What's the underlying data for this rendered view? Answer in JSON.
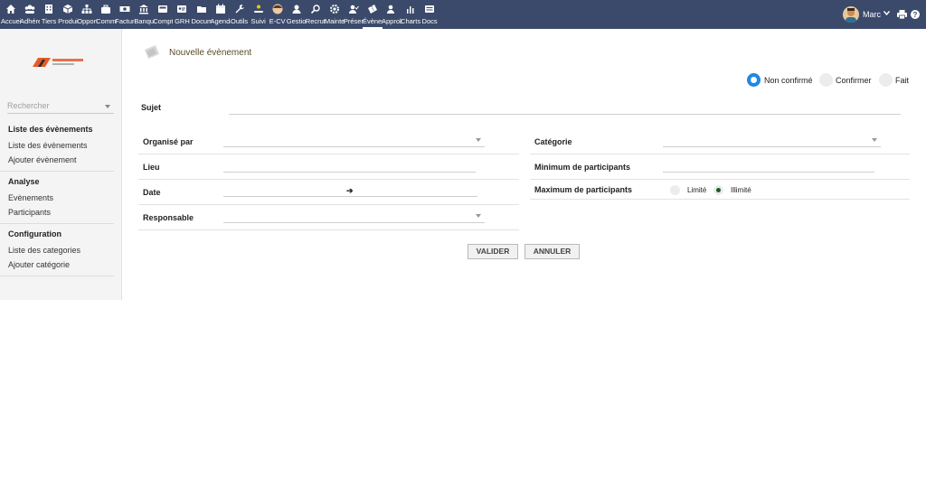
{
  "nav": {
    "items": [
      {
        "label": "Accueil",
        "icon": "home-icon"
      },
      {
        "label": "Adhérents",
        "icon": "members-icon"
      },
      {
        "label": "Tiers",
        "icon": "building-icon"
      },
      {
        "label": "Produits",
        "icon": "cube-icon"
      },
      {
        "label": "Opportunités",
        "icon": "sitemap-icon"
      },
      {
        "label": "Commercial",
        "icon": "briefcase-icon"
      },
      {
        "label": "Factures",
        "icon": "money-icon"
      },
      {
        "label": "Banque",
        "icon": "bank-icon"
      },
      {
        "label": "Comptabilité",
        "icon": "calculator-icon"
      },
      {
        "label": "GRH",
        "icon": "id-card-icon"
      },
      {
        "label": "Documents",
        "icon": "folder-icon"
      },
      {
        "label": "Agenda",
        "icon": "calendar-icon"
      },
      {
        "label": "Outils",
        "icon": "wrench-icon"
      },
      {
        "label": "Suivi",
        "icon": "hand-coin-icon"
      },
      {
        "label": "E-CV",
        "icon": "face-icon"
      },
      {
        "label": "Gestion",
        "icon": "user-tie-icon"
      },
      {
        "label": "Recrutement",
        "icon": "search-person-icon"
      },
      {
        "label": "Maintenance",
        "icon": "gear-icon"
      },
      {
        "label": "Présences",
        "icon": "person-check-icon"
      },
      {
        "label": "Évènements",
        "icon": "ticket-icon"
      },
      {
        "label": "Approbations",
        "icon": "approve-icon"
      },
      {
        "label": "Charts",
        "icon": "chart-icon"
      },
      {
        "label": "Docs",
        "icon": "db-icon"
      }
    ],
    "active_index": 19
  },
  "user": {
    "name": "Marc"
  },
  "sidebar": {
    "search_placeholder": "Rechercher",
    "sections": [
      {
        "title": "Liste des évènements",
        "links": [
          "Liste des évènements",
          "Ajouter évènement"
        ]
      },
      {
        "title": "Analyse",
        "links": [
          "Evènements",
          "Participants"
        ]
      },
      {
        "title": "Configuration",
        "links": [
          "Liste des categories",
          "Ajouter catégorie"
        ]
      }
    ]
  },
  "form": {
    "title": "Nouvelle évènement",
    "status_options": [
      {
        "label": "Non confirmé",
        "checked": true
      },
      {
        "label": "Confirmer",
        "checked": false
      },
      {
        "label": "Fait",
        "checked": false
      }
    ],
    "subject_label": "Sujet",
    "subject_value": "",
    "left_fields": {
      "organise_par": "Organisé par",
      "lieu": "Lieu",
      "date": "Date",
      "date_arrow": "➔",
      "responsable": "Responsable"
    },
    "right_fields": {
      "categorie": "Catégorie",
      "min_participants": "Minimum de participants",
      "max_participants": "Maximum de participants",
      "max_limited_label": "Limité",
      "max_unlimited_label": "Illimité",
      "max_selected": "Illimité"
    },
    "buttons": {
      "validate": "VALIDER",
      "cancel": "ANNULER"
    }
  },
  "colors": {
    "topbar": "#3b4a6b",
    "radio_checked": "#1e88e5",
    "title_text": "#5a4a2a"
  }
}
